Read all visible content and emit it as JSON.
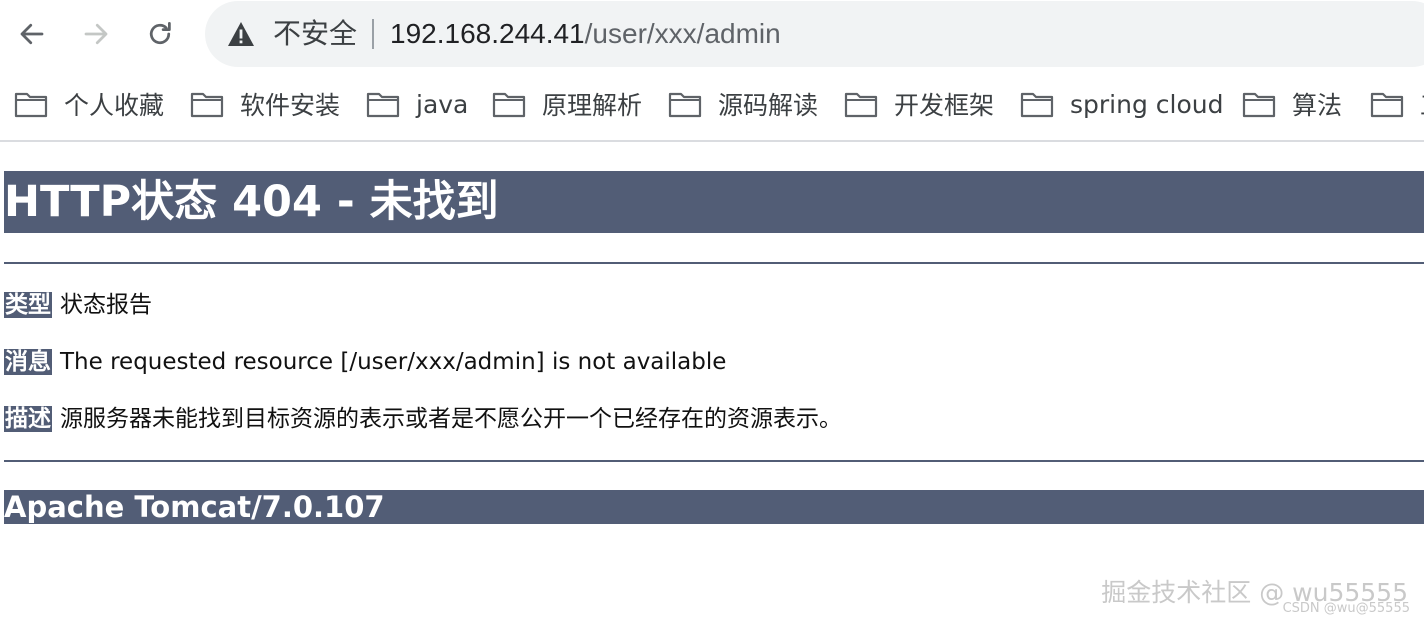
{
  "browser": {
    "security_label": "不安全",
    "url_host": "192.168.244.41",
    "url_path": "/user/xxx/admin"
  },
  "bookmarks": [
    {
      "label": "个人收藏"
    },
    {
      "label": "软件安装"
    },
    {
      "label": "java"
    },
    {
      "label": "原理解析"
    },
    {
      "label": "源码解读"
    },
    {
      "label": "开发框架"
    },
    {
      "label": "spring cloud"
    },
    {
      "label": "算法"
    },
    {
      "label": "工"
    }
  ],
  "page": {
    "title": "HTTP状态 404 - 未找到",
    "type_label": "类型",
    "type_value": "状态报告",
    "message_label": "消息",
    "message_value": "The requested resource [/user/xxx/admin] is not available",
    "description_label": "描述",
    "description_value": "源服务器未能找到目标资源的表示或者是不愿公开一个已经存在的资源表示。",
    "footer": "Apache Tomcat/7.0.107"
  },
  "watermark": {
    "main": "掘金技术社区 @ wu55555",
    "sub": "CSDN @wu@55555"
  }
}
